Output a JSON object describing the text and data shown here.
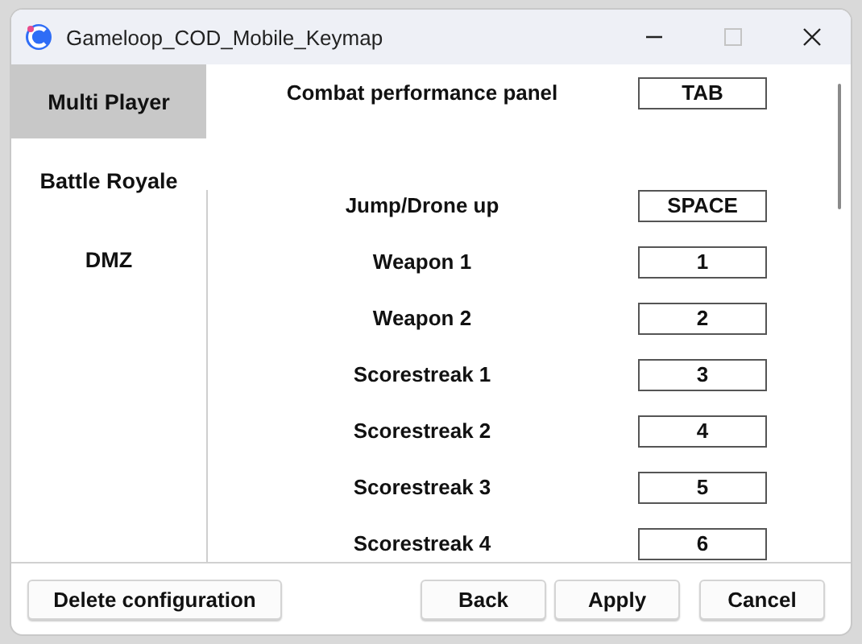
{
  "window": {
    "title": "Gameloop_COD_Mobile_Keymap"
  },
  "sidebar": {
    "items": [
      {
        "label": "Multi Player",
        "selected": true
      },
      {
        "label": "Battle Royale",
        "selected": false
      },
      {
        "label": "DMZ",
        "selected": false
      }
    ]
  },
  "pinned_binding": {
    "action": "Combat performance panel",
    "key": "TAB"
  },
  "bindings": [
    {
      "action": "Jump/Drone up",
      "key": "SPACE"
    },
    {
      "action": "Weapon 1",
      "key": "1"
    },
    {
      "action": "Weapon 2",
      "key": "2"
    },
    {
      "action": "Scorestreak 1",
      "key": "3"
    },
    {
      "action": "Scorestreak 2",
      "key": "4"
    },
    {
      "action": "Scorestreak 3",
      "key": "5"
    },
    {
      "action": "Scorestreak 4",
      "key": "6"
    }
  ],
  "buttons_left": [
    "Delete configuration"
  ],
  "buttons_right": [
    "Back",
    "Apply",
    "Cancel"
  ]
}
